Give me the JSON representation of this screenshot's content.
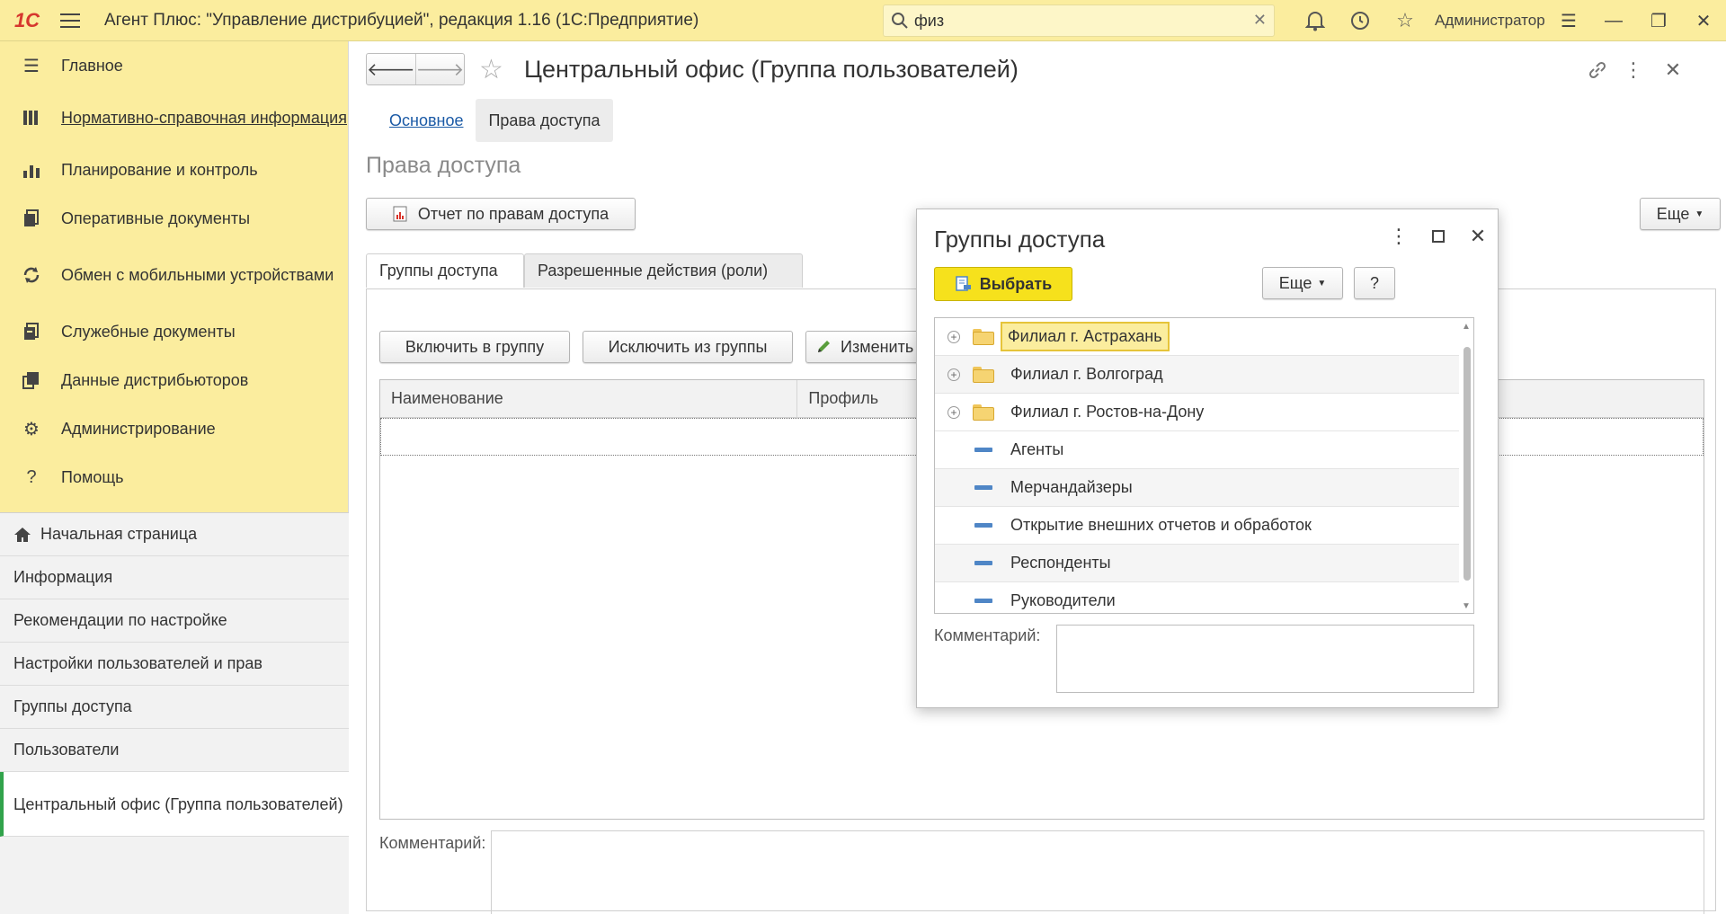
{
  "app": {
    "logo": "1С",
    "title": "Агент Плюс: \"Управление дистрибуцией\", редакция 1.16  (1С:Предприятие)",
    "search_value": "физ",
    "user": "Администратор"
  },
  "sidebar": {
    "sections": [
      {
        "label": "Главное",
        "icon": "menu-icon"
      },
      {
        "label": "Нормативно-справочная информация",
        "icon": "books-icon"
      },
      {
        "label": "Планирование и контроль",
        "icon": "bar-chart-icon"
      },
      {
        "label": "Оперативные документы",
        "icon": "documents-icon"
      },
      {
        "label": "Обмен с мобильными устройствами",
        "icon": "sync-icon"
      },
      {
        "label": "Служебные документы",
        "icon": "service-docs-icon"
      },
      {
        "label": "Данные дистрибьюторов",
        "icon": "distributor-data-icon"
      },
      {
        "label": "Администрирование",
        "icon": "gear-icon"
      },
      {
        "label": "Помощь",
        "icon": "help-icon"
      }
    ],
    "open_windows": [
      {
        "label": "Начальная страница"
      },
      {
        "label": "Информация"
      },
      {
        "label": "Рекомендации по настройке"
      },
      {
        "label": "Настройки пользователей и прав"
      },
      {
        "label": "Группы доступа"
      },
      {
        "label": "Пользователи"
      },
      {
        "label": "Центральный офис (Группа пользователей)"
      }
    ]
  },
  "form": {
    "title": "Центральный офис (Группа пользователей)",
    "tabs": [
      {
        "label": "Основное"
      },
      {
        "label": "Права доступа"
      }
    ],
    "subtitle": "Права доступа",
    "report_button": "Отчет по правам доступа",
    "more_button": "Еще",
    "help_button": "?",
    "inner_tabs": [
      {
        "label": "Группы доступа"
      },
      {
        "label": "Разрешенные действия (роли)"
      }
    ],
    "include_button": "Включить в группу",
    "exclude_button": "Исключить из группы",
    "edit_button": "Изменить",
    "columns": [
      "Наименование",
      "Профиль"
    ],
    "comment_label": "Комментарий:"
  },
  "dialog": {
    "title": "Группы доступа",
    "select_button": "Выбрать",
    "more_button": "Еще",
    "help_button": "?",
    "items": [
      {
        "label": "Филиал г. Астрахань",
        "kind": "folder"
      },
      {
        "label": "Филиал г. Волгоград",
        "kind": "folder"
      },
      {
        "label": "Филиал г. Ростов-на-Дону",
        "kind": "folder"
      },
      {
        "label": "Агенты",
        "kind": "item"
      },
      {
        "label": "Мерчандайзеры",
        "kind": "item"
      },
      {
        "label": "Открытие внешних отчетов и обработок",
        "kind": "item"
      },
      {
        "label": "Респонденты",
        "kind": "item"
      },
      {
        "label": "Руководители",
        "kind": "item"
      }
    ],
    "comment_label": "Комментарий:"
  }
}
